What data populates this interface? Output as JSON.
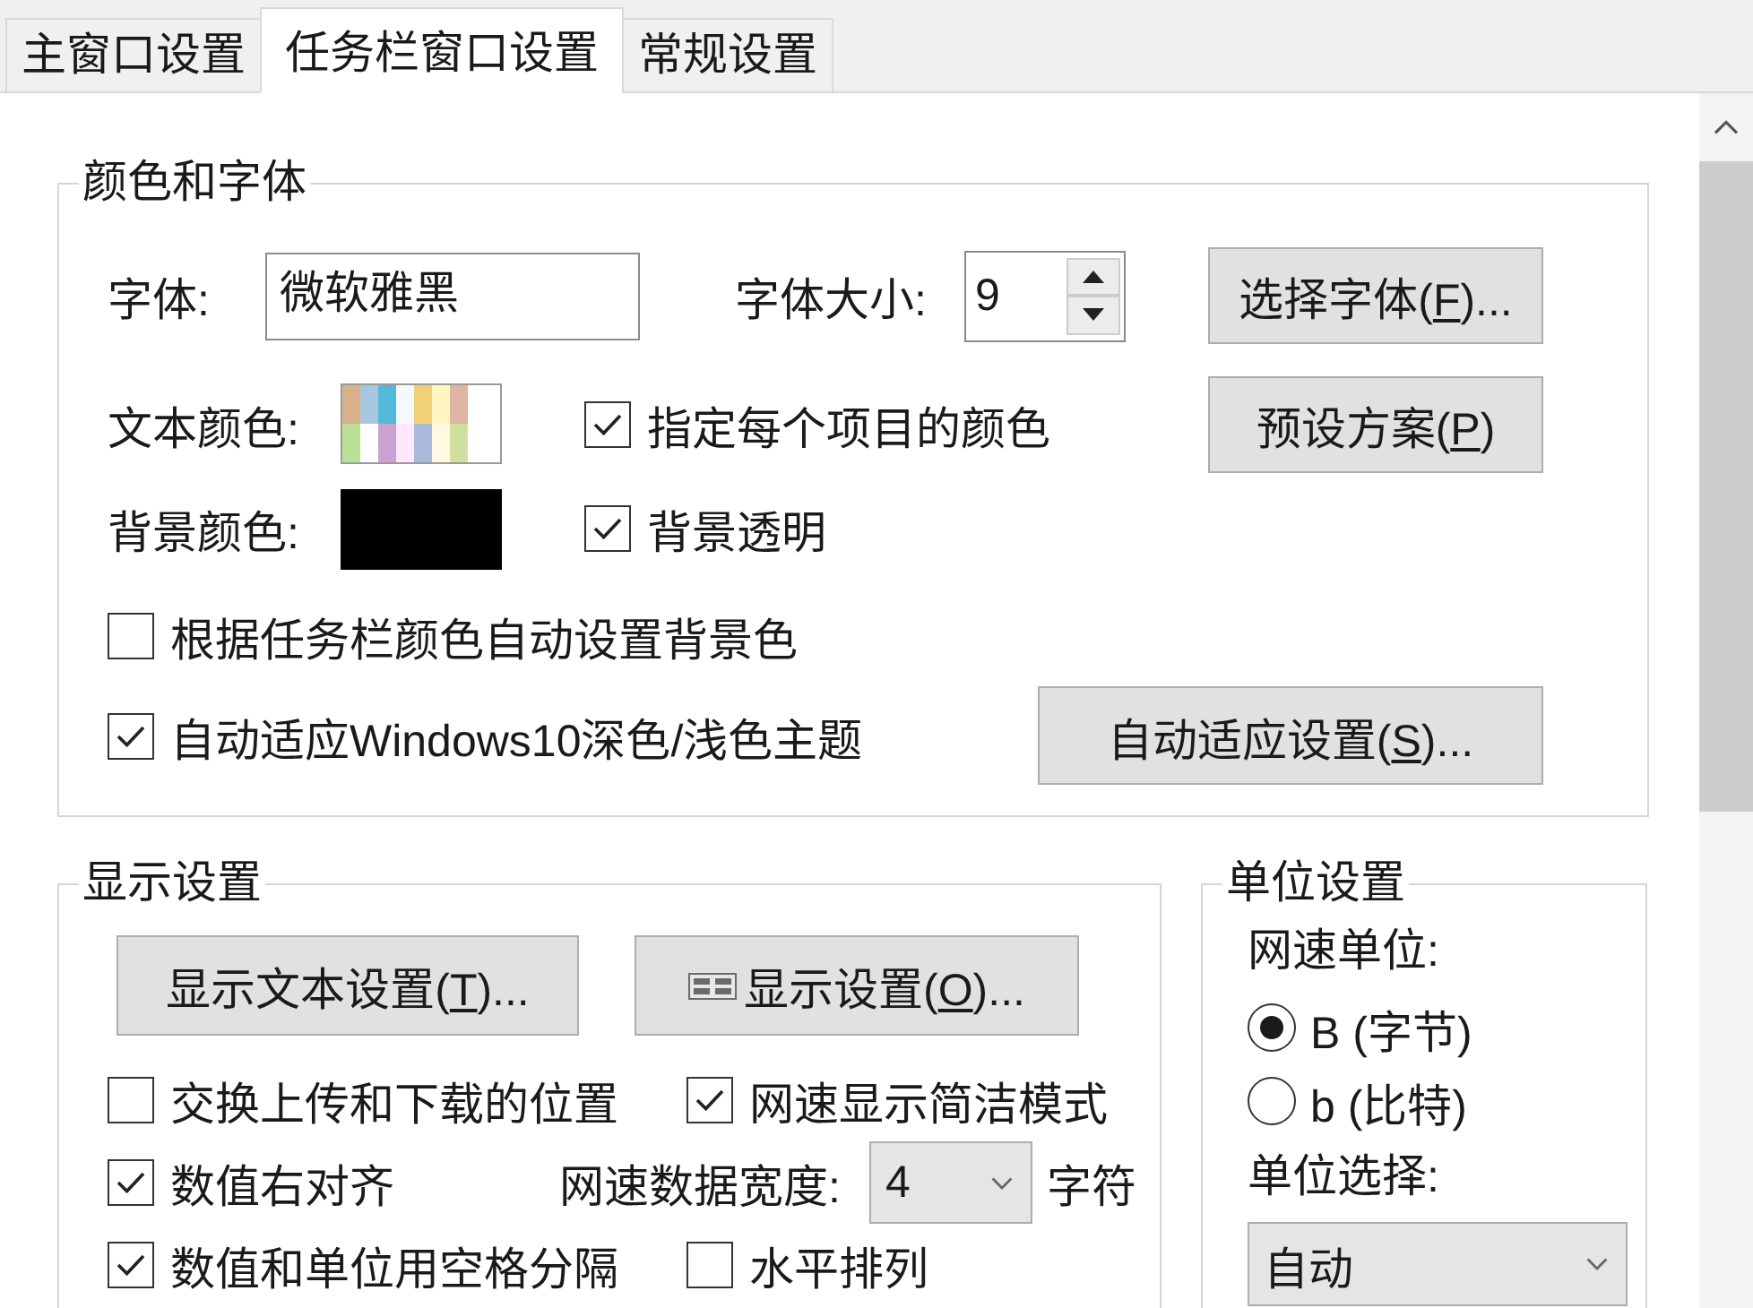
{
  "tabs": [
    {
      "label": "主窗口设置",
      "selected": false
    },
    {
      "label": "任务栏窗口设置",
      "selected": true
    },
    {
      "label": "常规设置",
      "selected": false
    }
  ],
  "color_and_font": {
    "title": "颜色和字体",
    "font": {
      "label": "字体:",
      "value": "微软雅黑"
    },
    "font_size": {
      "label": "字体大小:",
      "value": "9"
    },
    "choose_font_button": {
      "before": "选择字体(",
      "key": "F",
      "after": ")..."
    },
    "text_color": {
      "label": "文本颜色:"
    },
    "per_item_color": {
      "label": "指定每个项目的颜色",
      "checked": true
    },
    "preset_button": {
      "before": "预设方案(",
      "key": "P",
      "after": ")"
    },
    "background_color": {
      "label": "背景颜色:",
      "color": "#000000"
    },
    "transparent_background": {
      "label": "背景透明",
      "checked": true
    },
    "auto_background": {
      "label": "根据任务栏颜色自动设置背景色",
      "checked": false
    },
    "auto_theme": {
      "label": "自动适应Windows10深色/浅色主题",
      "checked": true
    },
    "auto_theme_button": {
      "before": "自动适应设置(",
      "key": "S",
      "after": ")..."
    }
  },
  "display_settings": {
    "title": "显示设置",
    "text_button": {
      "before": "显示文本设置(",
      "key": "T",
      "after": ")..."
    },
    "display_button": {
      "before": "显示设置(",
      "key": "O",
      "after": ")..."
    },
    "options": [
      {
        "kind": "checkbox",
        "label": "交换上传和下载的位置",
        "checked": false
      },
      {
        "kind": "checkbox",
        "label": "网速显示简洁模式",
        "checked": true
      },
      {
        "kind": "checkbox",
        "label": "数值右对齐",
        "checked": true
      },
      {
        "kind": "width_select",
        "label": "网速数据宽度:",
        "value": "4",
        "unit": "字符"
      },
      {
        "kind": "checkbox",
        "label": "数值和单位用空格分隔",
        "checked": true
      },
      {
        "kind": "checkbox",
        "label": "水平排列",
        "checked": false
      }
    ]
  },
  "unit_settings": {
    "title": "单位设置",
    "speed_unit_label": "网速单位:",
    "units": [
      {
        "label": "B (字节)",
        "selected": true
      },
      {
        "label": "b (比特)",
        "selected": false
      }
    ],
    "unit_choice_label": "单位选择:",
    "unit_choice": "自动"
  }
}
